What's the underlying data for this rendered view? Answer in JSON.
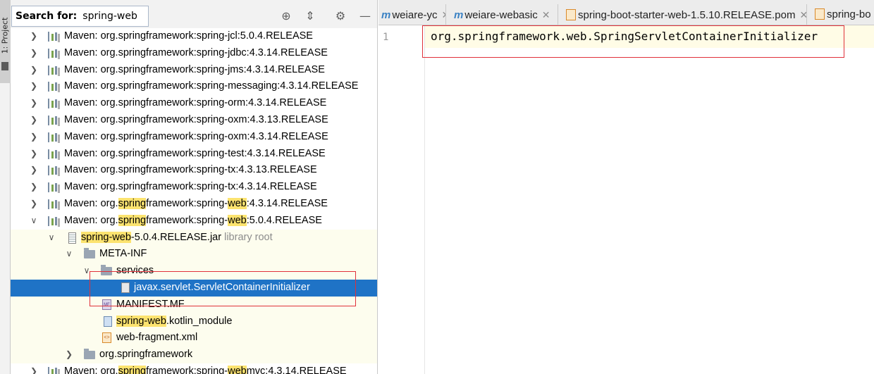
{
  "side_stripe": {
    "label": "1: Project"
  },
  "search": {
    "label": "Search for:",
    "value": "spring-web"
  },
  "toolbar": {
    "icons": [
      "target-icon",
      "collapse-icon",
      "gear-icon",
      "minimize-icon"
    ]
  },
  "tree": {
    "rows": [
      {
        "pre": "Maven: org.springframework:spring-jcl:5.0.4.RELEASE"
      },
      {
        "pre": "Maven: org.springframework:spring-jdbc:4.3.14.RELEASE"
      },
      {
        "pre": "Maven: org.springframework:spring-jms:4.3.14.RELEASE"
      },
      {
        "pre": "Maven: org.springframework:spring-messaging:4.3.14.RELEASE"
      },
      {
        "pre": "Maven: org.springframework:spring-orm:4.3.14.RELEASE"
      },
      {
        "pre": "Maven: org.springframework:spring-oxm:4.3.13.RELEASE"
      },
      {
        "pre": "Maven: org.springframework:spring-oxm:4.3.14.RELEASE"
      },
      {
        "pre": "Maven: org.springframework:spring-test:4.3.14.RELEASE"
      },
      {
        "pre": "Maven: org.springframework:spring-tx:4.3.13.RELEASE"
      },
      {
        "pre": "Maven: org.springframework:spring-tx:4.3.14.RELEASE"
      },
      {
        "pre": "Maven: org.",
        "hl1": "spring",
        "mid": "framework:spring-",
        "hl2": "web",
        "post": ":4.3.14.RELEASE"
      },
      {
        "pre": "Maven: org.",
        "hl1": "spring",
        "mid": "framework:spring-",
        "hl2": "web",
        "post": ":5.0.4.RELEASE"
      },
      {
        "hl1": "spring-web",
        "mid": "-5.0.4.RELEASE.jar",
        "gray": "library root"
      },
      {
        "pre": "META-INF"
      },
      {
        "pre": "services"
      },
      {
        "pre": "javax.servlet.ServletContainerInitializer"
      },
      {
        "pre": "MANIFEST.MF"
      },
      {
        "hl1": "spring-web",
        "mid": ".kotlin_module"
      },
      {
        "pre": "web-fragment.xml"
      },
      {
        "pre": "org.springframework"
      },
      {
        "pre": "Maven: org.",
        "hl1": "spring",
        "mid": "framework:spring-",
        "hl2": "web",
        "post": "mvc:4.3.14.RELEASE"
      }
    ]
  },
  "tabs": [
    {
      "label": "weiare-yc"
    },
    {
      "label": "weiare-webasic"
    },
    {
      "label": "spring-boot-starter-web-1.5.10.RELEASE.pom"
    },
    {
      "label": "spring-bo"
    }
  ],
  "editor": {
    "line_number": "1",
    "code": "org.springframework.web.SpringServletContainerInitializer"
  }
}
